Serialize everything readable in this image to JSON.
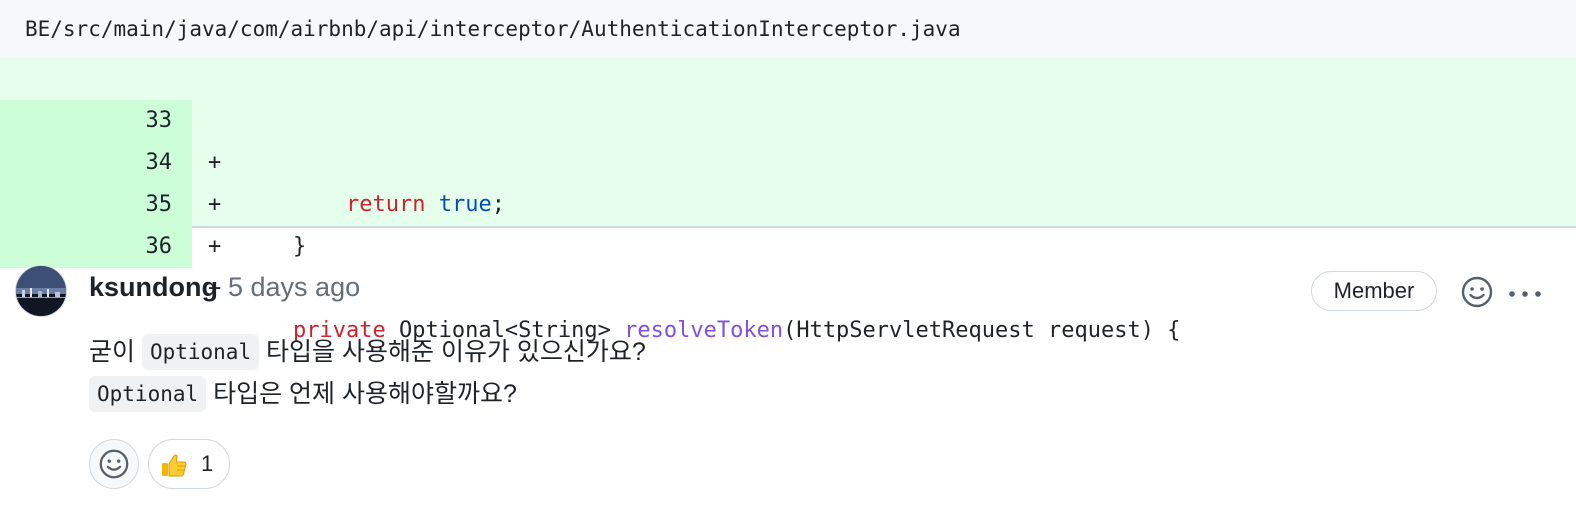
{
  "file": {
    "path": "BE/src/main/java/com/airbnb/api/interceptor/AuthenticationInterceptor.java"
  },
  "diff": {
    "lines": [
      {
        "num": "33",
        "marker": "+",
        "indent": "        ",
        "t1": "return",
        "t2": " ",
        "t3": "true",
        "t4": ";"
      },
      {
        "num": "34",
        "marker": "+",
        "indent": "    ",
        "t1": "}"
      },
      {
        "num": "35",
        "marker": "+"
      },
      {
        "num": "36",
        "marker": "+",
        "indent": "    ",
        "t1": "private",
        "t2": " Optional<String> ",
        "t3": "resolveToken",
        "t4": "(HttpServletRequest request) {"
      }
    ]
  },
  "comment": {
    "author": "ksundong",
    "time": "5 days ago",
    "badge": "Member",
    "line1": {
      "prefix": "굳이 ",
      "code": "Optional",
      "suffix": " 타입을 사용해준 이유가 있으신가요?"
    },
    "line2": {
      "code": "Optional",
      "suffix": " 타입은 언제 사용해야할까요?"
    },
    "reactions": [
      {
        "icon": "thumbs-up-icon",
        "emoji": "👍",
        "count": "1"
      }
    ]
  },
  "colors": {
    "added_bg": "#e6ffec",
    "added_num_bg": "#ccffd8",
    "keyword": "#cf222e",
    "literal": "#0550ae",
    "function": "#8250df"
  }
}
